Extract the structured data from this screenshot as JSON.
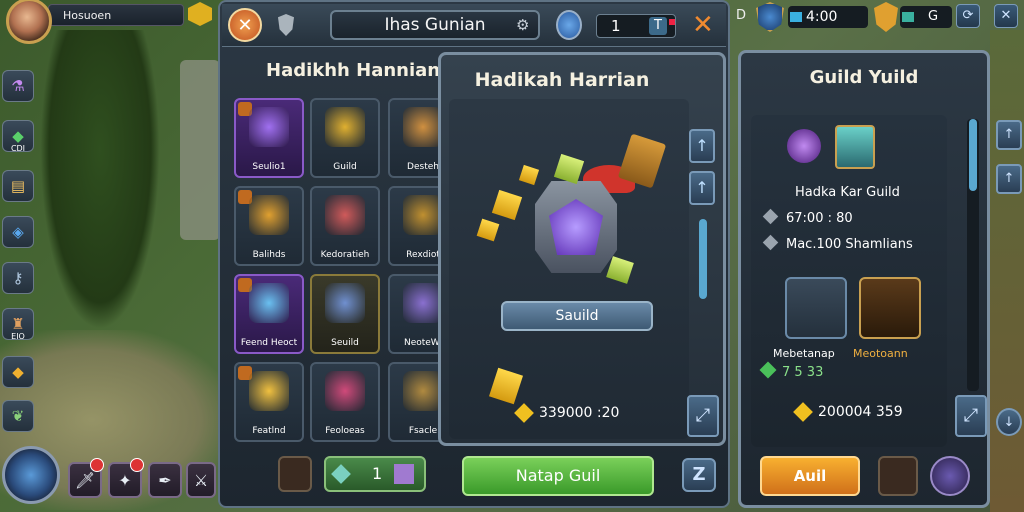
{
  "profile": {
    "name": "Hosuoen"
  },
  "sidebar": [
    {
      "icon": "potion-icon",
      "label": ""
    },
    {
      "icon": "emerald-icon",
      "label": "CDI"
    },
    {
      "icon": "scroll-icon",
      "label": ""
    },
    {
      "icon": "sapphire-icon",
      "label": ""
    },
    {
      "icon": "key-icon",
      "label": ""
    },
    {
      "icon": "tower-icon",
      "label": "EIO"
    },
    {
      "icon": "gold-gem-icon",
      "label": ""
    },
    {
      "icon": "leaf-icon",
      "label": ""
    }
  ],
  "main_panel": {
    "title": "Ihas Gunian",
    "counter": "1",
    "counter_badge": "T",
    "subtitle": "Hadikhh Hannian",
    "grid": [
      {
        "label": "Seulio1",
        "style": "purple"
      },
      {
        "label": "Guild",
        "style": "plain"
      },
      {
        "label": "Desteh",
        "style": "plain"
      },
      {
        "label": "Balihds",
        "style": "plain"
      },
      {
        "label": "Kedoratieh",
        "style": "plain"
      },
      {
        "label": "Rexdiot",
        "style": "plain"
      },
      {
        "label": "Feend Heoct",
        "style": "purple"
      },
      {
        "label": "Seuild",
        "style": "gold"
      },
      {
        "label": "NeoteWi",
        "style": "plain"
      },
      {
        "label": "Featlnd",
        "style": "plain"
      },
      {
        "label": "Feoloeas",
        "style": "plain"
      },
      {
        "label": "Fsacle",
        "style": "plain"
      }
    ],
    "quantity": "1",
    "primary_button": "Natap Guil",
    "z_button": "Z"
  },
  "popup": {
    "title": "Hadikah Harrian",
    "button": "Sauild",
    "price": "339000 :20"
  },
  "right_top": {
    "prefix": "D",
    "timer": "4:00",
    "count": "G"
  },
  "right_panel": {
    "title": "Guild Yuild",
    "guild_name": "Hadka Kar Guild",
    "time": "67:00 : 80",
    "members": "Mac.100 Shamlians",
    "slot1_label": "Mebetanap",
    "slot2_label": "Meotoann",
    "green_value": "7 5 33",
    "price": "200004 359",
    "action_button": "Auil"
  },
  "colors": {
    "accent_green": "#3a9a2a",
    "accent_orange": "#d0701a",
    "panel_border": "#7a8ea0"
  }
}
